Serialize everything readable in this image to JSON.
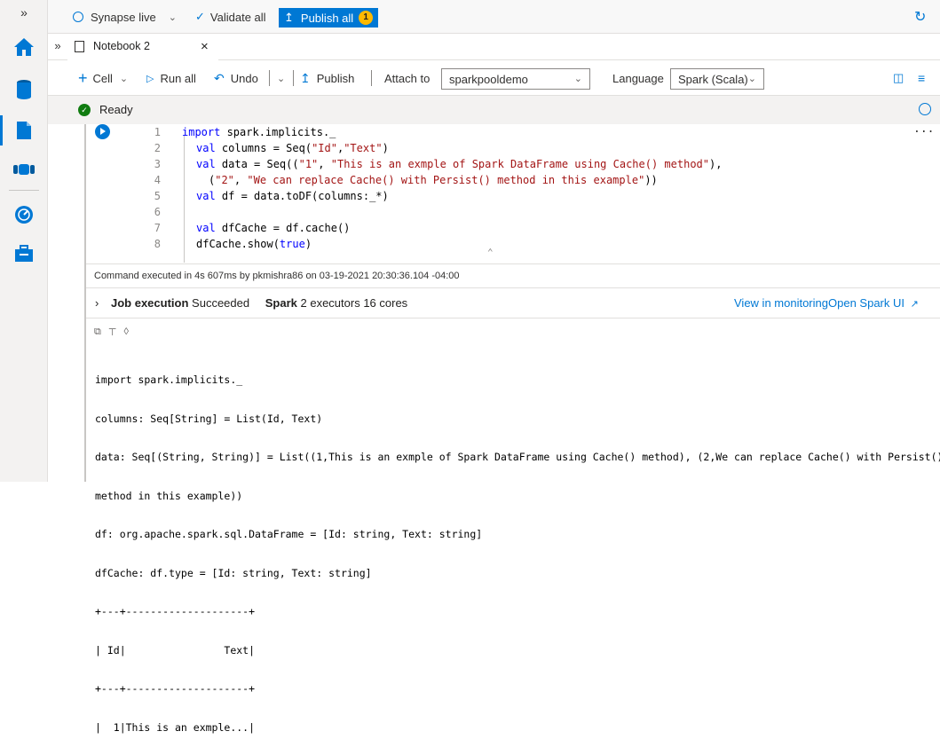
{
  "rail": {
    "expand_label": "»",
    "icons": [
      "home-icon",
      "data-icon",
      "develop-icon",
      "integrate-icon",
      "monitor-icon",
      "manage-icon"
    ]
  },
  "topbar": {
    "workspace_label": "Synapse live",
    "validate_label": "Validate all",
    "publish_label": "Publish all",
    "publish_count": "1"
  },
  "tabs": {
    "collapse_label": "»",
    "notebook_title": "Notebook 2",
    "close_label": "×"
  },
  "toolbar": {
    "cell_label": "Cell",
    "run_all_label": "Run all",
    "undo_label": "Undo",
    "publish_label": "Publish",
    "attach_to_label": "Attach to",
    "attach_to_value": "sparkpooldemo",
    "language_label": "Language",
    "language_value": "Spark (Scala)"
  },
  "status": {
    "ready_label": "Ready"
  },
  "cell": {
    "line_numbers": [
      "1",
      "2",
      "3",
      "4",
      "5",
      "6",
      "7",
      "8"
    ],
    "more_label": "..."
  },
  "execution": {
    "summary": "Command executed in 4s 607ms by pkmishra86 on 03-19-2021 20:30:36.104 -04:00",
    "job_label": "Job execution",
    "job_status": "Succeeded",
    "spark_label": "Spark",
    "spark_detail": "2 executors 16 cores",
    "view_monitoring": "View in monitoring",
    "open_spark_ui": "Open Spark UI"
  },
  "output": {
    "lines": [
      "import spark.implicits._",
      "columns: Seq[String] = List(Id, Text)",
      "data: Seq[(String, String)] = List((1,This is an exmple of Spark DataFrame using Cache() method), (2,We can replace Cache() with Persist()",
      "method in this example))",
      "df: org.apache.spark.sql.DataFrame = [Id: string, Text: string]",
      "dfCache: df.type = [Id: string, Text: string]",
      "+---+--------------------+",
      "| Id|                Text|",
      "+---+--------------------+",
      "|  1|This is an exmple...|"
    ]
  },
  "colors": {
    "accent": "#0078d4",
    "badge": "#ffb900",
    "ready": "#107c10",
    "keyword": "#0000ff",
    "string": "#a31515"
  }
}
